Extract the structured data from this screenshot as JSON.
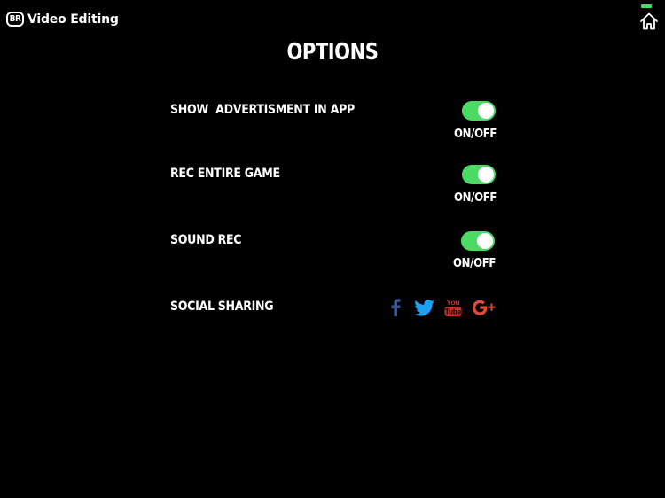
{
  "header": {
    "logo_badge": "BR",
    "logo_text": "Video Editing",
    "home_icon": "home-icon"
  },
  "page": {
    "title": "OPTIONS"
  },
  "options": [
    {
      "label": "SHOW  ADVERTISMENT IN APP",
      "toggle_label": "ON/OFF",
      "state": "on"
    },
    {
      "label": "REC ENTIRE GAME",
      "toggle_label": "ON/OFF",
      "state": "on"
    },
    {
      "label": "SOUND REC",
      "toggle_label": "ON/OFF",
      "state": "on"
    }
  ],
  "social": {
    "label": "SOCIAL SHARING",
    "youtube_text_top": "You",
    "youtube_text_bottom": "Tube",
    "icons": [
      "facebook-icon",
      "twitter-icon",
      "youtube-icon",
      "google-plus-icon"
    ]
  },
  "colors": {
    "background": "#000000",
    "toggle_on": "#4cd964",
    "facebook": "#3b5998",
    "twitter": "#1da1f2",
    "youtube": "#c4302b",
    "google_plus": "#dd4b39"
  }
}
